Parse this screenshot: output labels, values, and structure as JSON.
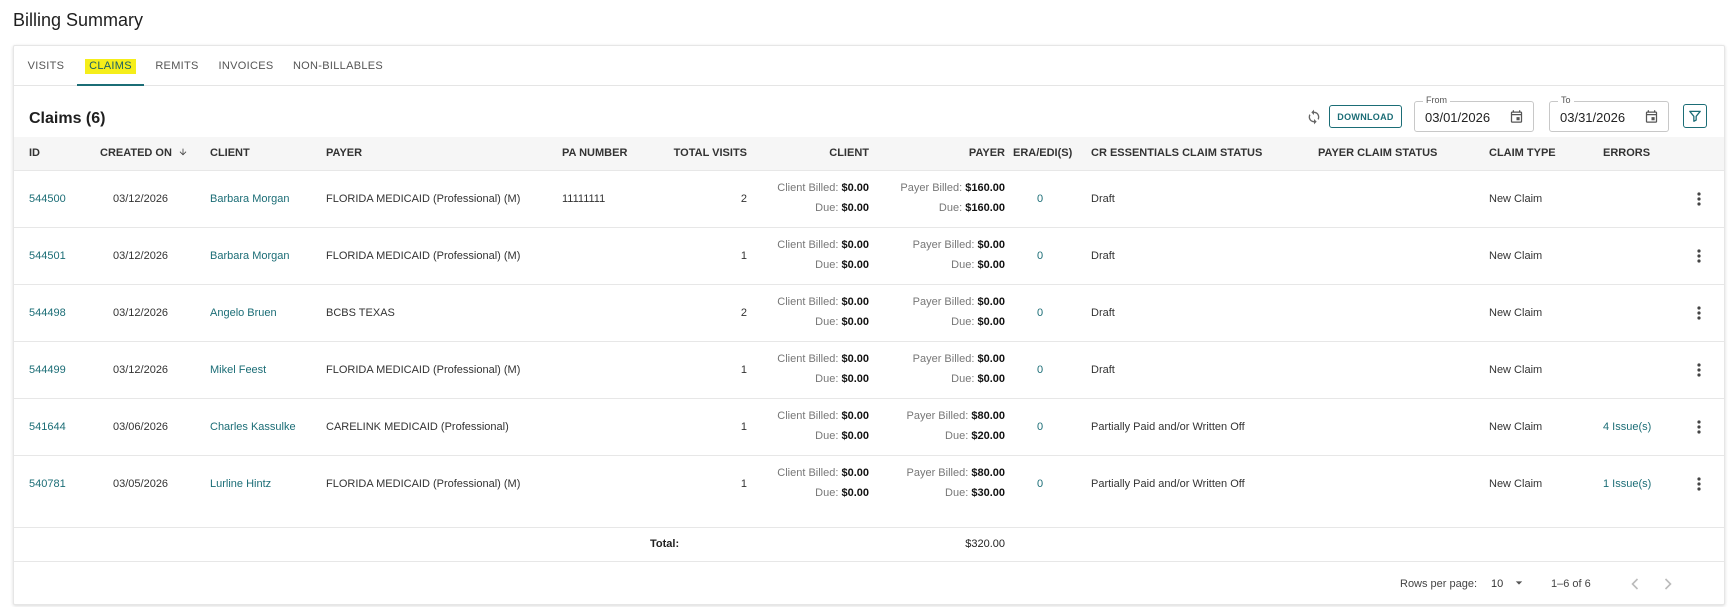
{
  "page": {
    "title": "Billing Summary"
  },
  "tabs": [
    {
      "label": "VISITS",
      "active": false
    },
    {
      "label": "CLAIMS",
      "active": true
    },
    {
      "label": "REMITS",
      "active": false
    },
    {
      "label": "INVOICES",
      "active": false
    },
    {
      "label": "NON-BILLABLES",
      "active": false
    }
  ],
  "toolbar": {
    "title": "Claims (6)",
    "download_label": "DOWNLOAD",
    "from_label": "From",
    "from_value": "03/01/2026",
    "to_label": "To",
    "to_value": "03/31/2026",
    "icons": [
      "refresh-icon",
      "calendar-icon",
      "filter-icon"
    ]
  },
  "table": {
    "columns": [
      "ID",
      "CREATED ON",
      "CLIENT",
      "PAYER",
      "PA NUMBER",
      "TOTAL VISITS",
      "CLIENT",
      "PAYER",
      "ERA/EDI(S)",
      "CR ESSENTIALS CLAIM STATUS",
      "PAYER CLAIM STATUS",
      "CLAIM TYPE",
      "ERRORS"
    ],
    "labels": {
      "client_billed": "Client Billed:",
      "payer_billed": "Payer Billed:",
      "due": "Due:"
    },
    "rows": [
      {
        "id": "544500",
        "created_on": "03/12/2026",
        "client": "Barbara Morgan",
        "payer": "FLORIDA MEDICAID (Professional) (M)",
        "pa_number": "11111111",
        "total_visits": "2",
        "client_billed": "$0.00",
        "client_due": "$0.00",
        "payer_billed": "$160.00",
        "payer_due": "$160.00",
        "era_edi": "0",
        "cr_status": "Draft",
        "payer_status": "",
        "claim_type": "New Claim",
        "errors": ""
      },
      {
        "id": "544501",
        "created_on": "03/12/2026",
        "client": "Barbara Morgan",
        "payer": "FLORIDA MEDICAID (Professional) (M)",
        "pa_number": "",
        "total_visits": "1",
        "client_billed": "$0.00",
        "client_due": "$0.00",
        "payer_billed": "$0.00",
        "payer_due": "$0.00",
        "era_edi": "0",
        "cr_status": "Draft",
        "payer_status": "",
        "claim_type": "New Claim",
        "errors": ""
      },
      {
        "id": "544498",
        "created_on": "03/12/2026",
        "client": "Angelo Bruen",
        "payer": "BCBS TEXAS",
        "pa_number": "",
        "total_visits": "2",
        "client_billed": "$0.00",
        "client_due": "$0.00",
        "payer_billed": "$0.00",
        "payer_due": "$0.00",
        "era_edi": "0",
        "cr_status": "Draft",
        "payer_status": "",
        "claim_type": "New Claim",
        "errors": ""
      },
      {
        "id": "544499",
        "created_on": "03/12/2026",
        "client": "Mikel Feest",
        "payer": "FLORIDA MEDICAID (Professional) (M)",
        "pa_number": "",
        "total_visits": "1",
        "client_billed": "$0.00",
        "client_due": "$0.00",
        "payer_billed": "$0.00",
        "payer_due": "$0.00",
        "era_edi": "0",
        "cr_status": "Draft",
        "payer_status": "",
        "claim_type": "New Claim",
        "errors": ""
      },
      {
        "id": "541644",
        "created_on": "03/06/2026",
        "client": "Charles Kassulke",
        "payer": "CARELINK MEDICAID (Professional)",
        "pa_number": "",
        "total_visits": "1",
        "client_billed": "$0.00",
        "client_due": "$0.00",
        "payer_billed": "$80.00",
        "payer_due": "$20.00",
        "era_edi": "0",
        "cr_status": "Partially Paid and/or Written Off",
        "payer_status": "",
        "claim_type": "New Claim",
        "errors": "4 Issue(s)"
      },
      {
        "id": "540781",
        "created_on": "03/05/2026",
        "client": "Lurline Hintz",
        "payer": "FLORIDA MEDICAID (Professional) (M)",
        "pa_number": "",
        "total_visits": "1",
        "client_billed": "$0.00",
        "client_due": "$0.00",
        "payer_billed": "$80.00",
        "payer_due": "$30.00",
        "era_edi": "0",
        "cr_status": "Partially Paid and/or Written Off",
        "payer_status": "",
        "claim_type": "New Claim",
        "errors": "1 Issue(s)"
      }
    ],
    "total_label": "Total:",
    "total_value": "$320.00"
  },
  "pagination": {
    "rows_per_page_label": "Rows per page:",
    "rows_per_page_value": "10",
    "range_text": "1–6 of 6"
  },
  "colors": {
    "accent": "#1b6d76",
    "highlight": "#f5ee1a"
  }
}
